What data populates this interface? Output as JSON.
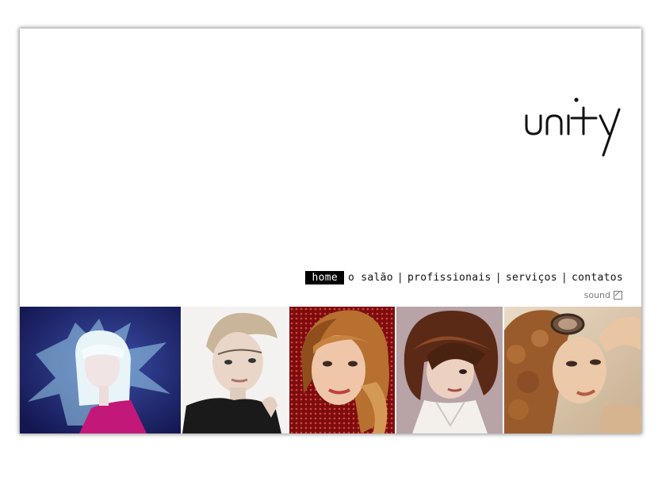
{
  "brand": {
    "logo_text": "unity"
  },
  "nav": {
    "items": [
      {
        "label": "home",
        "active": true
      },
      {
        "label": "o salão",
        "active": false
      },
      {
        "label": "profissionais",
        "active": false
      },
      {
        "label": "serviços",
        "active": false
      },
      {
        "label": "contatos",
        "active": false
      }
    ],
    "separator": "|"
  },
  "sound": {
    "label": "sound",
    "icon": "sound-toggle-icon"
  },
  "gallery": {
    "photos": [
      {
        "name": "platinum-blonde-model-photo",
        "bg": "#2a2f78"
      },
      {
        "name": "short-blonde-pixie-photo",
        "bg": "#f2f0ee"
      },
      {
        "name": "auburn-hair-red-backdrop-photo",
        "bg": "#9a1515"
      },
      {
        "name": "brunette-bob-photo",
        "bg": "#b8a4a8"
      },
      {
        "name": "curly-hair-goggles-photo",
        "bg": "#d8c4aa"
      }
    ]
  }
}
